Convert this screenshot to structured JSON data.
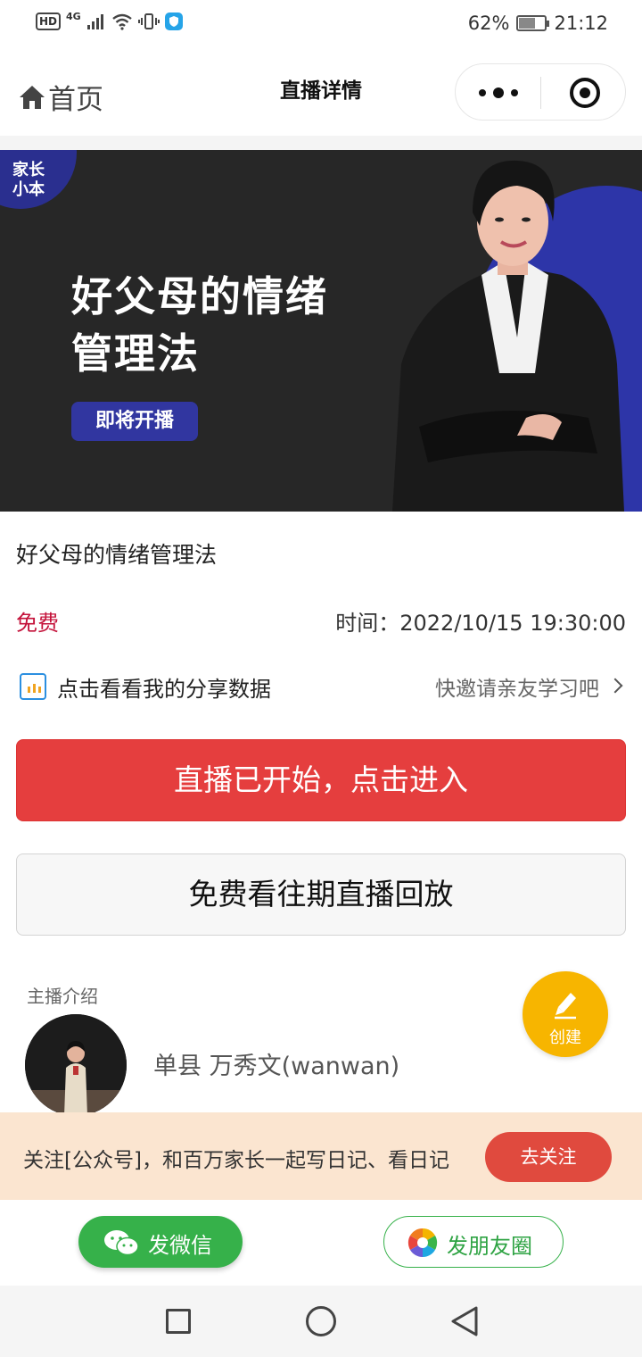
{
  "status_bar": {
    "hd": "HD",
    "network": "4G",
    "battery_percent": "62%",
    "battery_level": 0.62,
    "time": "21:12"
  },
  "nav": {
    "home_label": "首页",
    "title": "直播详情"
  },
  "banner": {
    "logo_line1": "家长",
    "logo_line2": "小本",
    "headline_line1": "好父母的情绪",
    "headline_line2": "管理法",
    "badge": "即将开播"
  },
  "course": {
    "title": "好父母的情绪管理法",
    "price": "免费",
    "time_label": "时间：",
    "time_value": "2022/10/15 19:30:00"
  },
  "share_stats": {
    "label": "点击看看我的分享数据",
    "invite": "快邀请亲友学习吧"
  },
  "buttons": {
    "enter_live": "直播已开始，点击进入",
    "replay": "免费看往期直播回放"
  },
  "host": {
    "section_label": "主播介绍",
    "name": "单县 万秀文(wanwan)"
  },
  "fab": {
    "label": "创建"
  },
  "follow": {
    "text": "关注[公众号]，和百万家长一起写日记、看日记",
    "button": "去关注"
  },
  "share": {
    "wechat": "发微信",
    "moments": "发朋友圈"
  },
  "colors": {
    "accent_red": "#e53e3e",
    "price_red": "#c4123a",
    "wechat_green": "#36b14a",
    "fab_yellow": "#f7b500",
    "banner_blue": "#2d35a8"
  }
}
